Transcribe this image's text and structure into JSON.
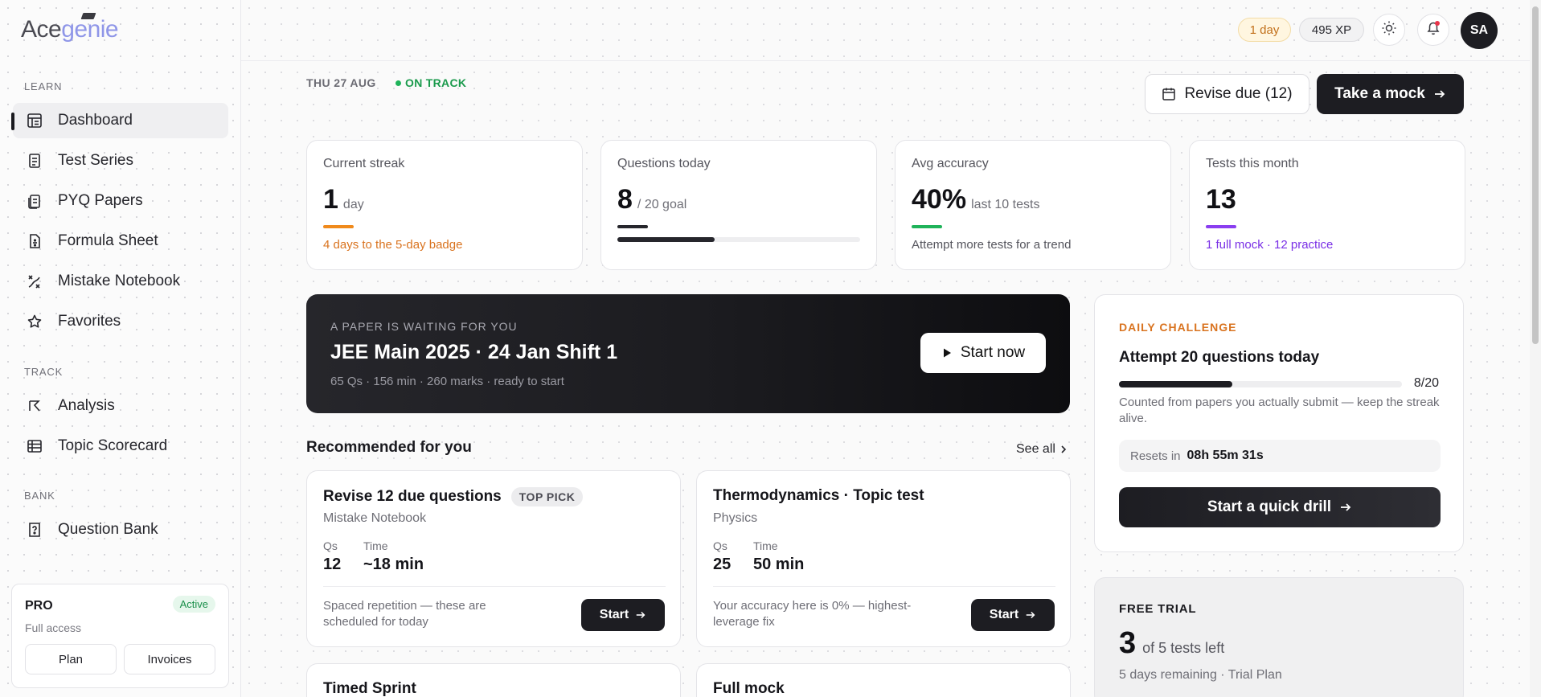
{
  "brand": {
    "part1": "Ace",
    "part2": "genie"
  },
  "sidebar": {
    "sections": [
      {
        "label": "LEARN"
      },
      {
        "label": "TRACK"
      },
      {
        "label": "BANK"
      }
    ],
    "items": [
      {
        "label": "Dashboard",
        "icon": "dashboard-icon"
      },
      {
        "label": "Test Series",
        "icon": "test-series-icon"
      },
      {
        "label": "PYQ Papers",
        "icon": "papers-icon"
      },
      {
        "label": "Formula Sheet",
        "icon": "formula-icon"
      },
      {
        "label": "Mistake Notebook",
        "icon": "mistake-icon"
      },
      {
        "label": "Favorites",
        "icon": "star-icon"
      },
      {
        "label": "Analysis",
        "icon": "analysis-icon"
      },
      {
        "label": "Topic Scorecard",
        "icon": "scorecard-icon"
      },
      {
        "label": "Question Bank",
        "icon": "question-bank-icon"
      }
    ],
    "plan": {
      "title": "PRO",
      "subtitle": "Full access",
      "status": "Active",
      "plan_button": "Plan",
      "invoices_button": "Invoices"
    }
  },
  "topbar": {
    "streak_chip": "1 day",
    "xp_chip": "495 XP",
    "avatar_initials": "SA"
  },
  "header": {
    "date": "THU 27 AUG",
    "status": "ON TRACK",
    "revise_button": "Revise due (12)",
    "mock_button": "Take a mock"
  },
  "stats": [
    {
      "label": "Current streak",
      "value": "1",
      "unit": "day",
      "sub": "4 days to the 5-day badge",
      "accent": "#f08a1c"
    },
    {
      "label": "Questions today",
      "value": "8",
      "unit": "/ 20 goal",
      "sub": "",
      "accent": "#26262c",
      "progress": 0.4
    },
    {
      "label": "Avg accuracy",
      "value": "40%",
      "unit": "last 10 tests",
      "sub": "Attempt more tests for a trend",
      "accent": "#1fb35a"
    },
    {
      "label": "Tests this month",
      "value": "13",
      "unit": "",
      "sub": "1 full mock · 12 practice",
      "accent": "#8a3ef0"
    }
  ],
  "hero": {
    "eyebrow": "A PAPER IS WAITING FOR YOU",
    "title": "JEE Main 2025 · 24 Jan Shift 1",
    "meta": "65 Qs · 156 min · 260 marks · ready to start",
    "button": "Start now"
  },
  "recommended": {
    "title": "Recommended for you",
    "see_all": "See all",
    "cards": [
      {
        "title": "Revise 12 due questions",
        "tag": "TOP PICK",
        "subtitle": "Mistake Notebook",
        "qs_label": "Qs",
        "qs": "12",
        "time_label": "Time",
        "time": "~18 min",
        "note": "Spaced repetition — these are scheduled for today",
        "button": "Start"
      },
      {
        "title": "Thermodynamics · Topic test",
        "tag": "",
        "subtitle": "Physics",
        "qs_label": "Qs",
        "qs": "25",
        "time_label": "Time",
        "time": "50 min",
        "note": "Your accuracy here is 0% — highest-leverage fix",
        "button": "Start"
      },
      {
        "title": "Timed Sprint"
      },
      {
        "title": "Full mock"
      }
    ]
  },
  "daily": {
    "eyebrow": "DAILY CHALLENGE",
    "title": "Attempt 20 questions today",
    "count": "8/20",
    "progress": 0.4,
    "note": "Counted from papers you actually submit — keep the streak alive.",
    "resets_label": "Resets in",
    "resets_value": "08h 55m 31s",
    "button": "Start a quick drill"
  },
  "trial": {
    "eyebrow": "FREE TRIAL",
    "value": "3",
    "unit": "of 5 tests left",
    "sub": "5 days remaining · Trial Plan"
  }
}
